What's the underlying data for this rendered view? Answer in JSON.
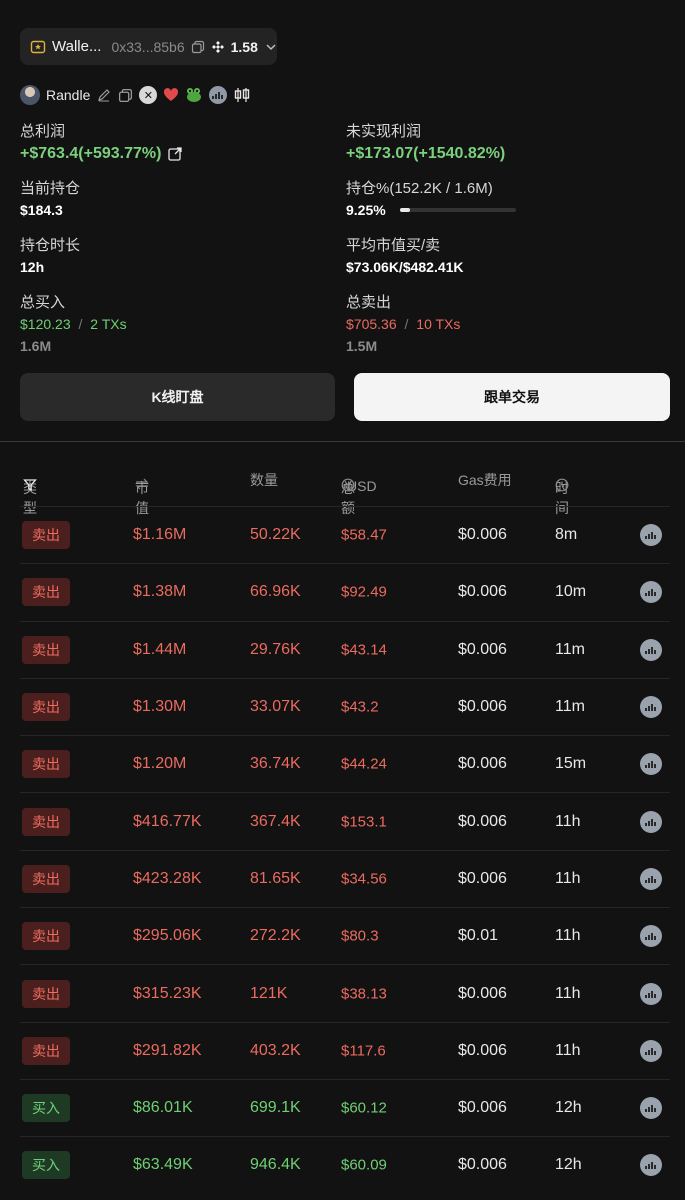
{
  "wallet": {
    "name": "Walle...",
    "address": "0x33...85b6",
    "balance": "1.58"
  },
  "user": {
    "name": "Randle"
  },
  "stats": {
    "total_profit_label": "总利润",
    "total_profit_value": "+$763.4(+593.77%)",
    "unrealized_label": "未实现利润",
    "unrealized_value": "+$173.07(+1540.82%)",
    "holding_label": "当前持仓",
    "holding_value": "$184.3",
    "holding_pct_label": "持仓%(152.2K / 1.6M)",
    "holding_pct_value": "9.25%",
    "holding_pct_fraction": 0.0925,
    "duration_label": "持仓时长",
    "duration_value": "12h",
    "avg_mc_label": "平均市值买/卖",
    "avg_mc_value": "$73.06K/$482.41K",
    "total_buy_label": "总买入",
    "total_buy_amount": "$120.23",
    "total_buy_sep": "/",
    "total_buy_txs": "2 TXs",
    "total_buy_qty": "1.6M",
    "total_sell_label": "总卖出",
    "total_sell_amount": "$705.36",
    "total_sell_sep": "/",
    "total_sell_txs": "10 TXs",
    "total_sell_qty": "1.5M"
  },
  "buttons": {
    "chart": "K线盯盘",
    "follow": "跟单交易"
  },
  "table": {
    "headers": {
      "type": "类型",
      "market_cap": "市值",
      "quantity": "数量",
      "total": "总额",
      "currency": "USD",
      "gas": "Gas费用",
      "time": "时间"
    },
    "rows": [
      {
        "type": "卖出",
        "side": "sell",
        "mc": "$1.16M",
        "qty": "50.22K",
        "total": "$58.47",
        "gas": "$0.006",
        "time": "8m"
      },
      {
        "type": "卖出",
        "side": "sell",
        "mc": "$1.38M",
        "qty": "66.96K",
        "total": "$92.49",
        "gas": "$0.006",
        "time": "10m"
      },
      {
        "type": "卖出",
        "side": "sell",
        "mc": "$1.44M",
        "qty": "29.76K",
        "total": "$43.14",
        "gas": "$0.006",
        "time": "11m"
      },
      {
        "type": "卖出",
        "side": "sell",
        "mc": "$1.30M",
        "qty": "33.07K",
        "total": "$43.2",
        "gas": "$0.006",
        "time": "11m"
      },
      {
        "type": "卖出",
        "side": "sell",
        "mc": "$1.20M",
        "qty": "36.74K",
        "total": "$44.24",
        "gas": "$0.006",
        "time": "15m"
      },
      {
        "type": "卖出",
        "side": "sell",
        "mc": "$416.77K",
        "qty": "367.4K",
        "total": "$153.1",
        "gas": "$0.006",
        "time": "11h"
      },
      {
        "type": "卖出",
        "side": "sell",
        "mc": "$423.28K",
        "qty": "81.65K",
        "total": "$34.56",
        "gas": "$0.006",
        "time": "11h"
      },
      {
        "type": "卖出",
        "side": "sell",
        "mc": "$295.06K",
        "qty": "272.2K",
        "total": "$80.3",
        "gas": "$0.01",
        "time": "11h"
      },
      {
        "type": "卖出",
        "side": "sell",
        "mc": "$315.23K",
        "qty": "121K",
        "total": "$38.13",
        "gas": "$0.006",
        "time": "11h"
      },
      {
        "type": "卖出",
        "side": "sell",
        "mc": "$291.82K",
        "qty": "403.2K",
        "total": "$117.6",
        "gas": "$0.006",
        "time": "11h"
      },
      {
        "type": "买入",
        "side": "buy",
        "mc": "$86.01K",
        "qty": "699.1K",
        "total": "$60.12",
        "gas": "$0.006",
        "time": "12h"
      },
      {
        "type": "买入",
        "side": "buy",
        "mc": "$63.49K",
        "qty": "946.4K",
        "total": "$60.09",
        "gas": "$0.006",
        "time": "12h"
      }
    ]
  }
}
